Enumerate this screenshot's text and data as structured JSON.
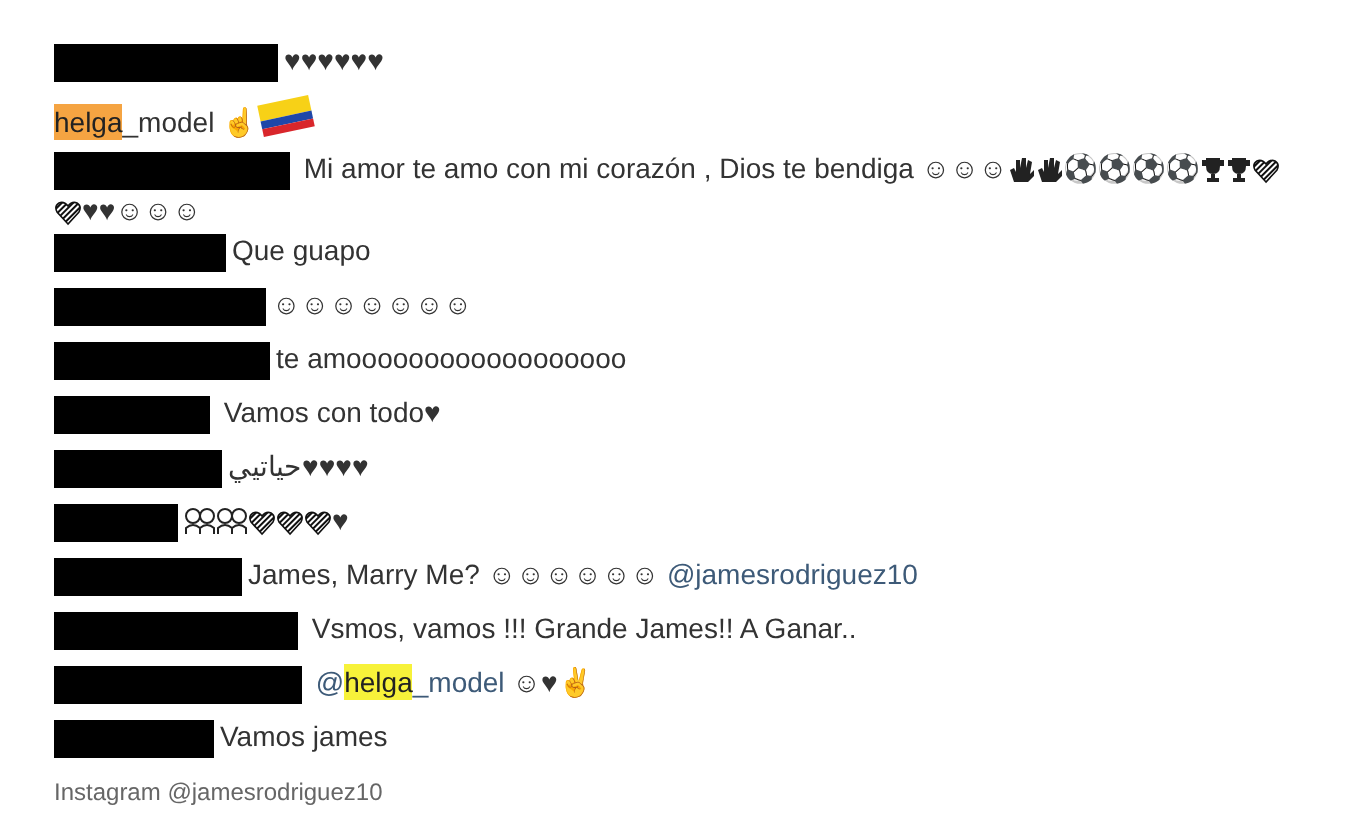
{
  "comments": [
    {
      "redacted": true,
      "segments": [
        {
          "kind": "text",
          "text": "♥♥♥♥♥♥"
        }
      ]
    },
    {
      "redacted": false,
      "segments": [
        {
          "kind": "highlight",
          "text": "helga",
          "color": "#f5a442"
        },
        {
          "kind": "text",
          "text": "_model "
        },
        {
          "kind": "text",
          "text": "☝"
        },
        {
          "kind": "flag"
        }
      ]
    },
    {
      "redacted": true,
      "segments": [
        {
          "kind": "text",
          "text": " Mi amor te amo con mi corazón , Dios te bendiga ☺☺☺"
        },
        {
          "kind": "hand"
        },
        {
          "kind": "hand"
        },
        {
          "kind": "text",
          "text": "⚽⚽⚽⚽"
        },
        {
          "kind": "trophy"
        },
        {
          "kind": "trophy"
        },
        {
          "kind": "stripe-heart"
        },
        {
          "kind": "stripe-heart"
        },
        {
          "kind": "text",
          "text": "♥♥☺☺☺"
        }
      ]
    },
    {
      "redacted": true,
      "segments": [
        {
          "kind": "text",
          "text": "Que guapo"
        }
      ]
    },
    {
      "redacted": true,
      "segments": [
        {
          "kind": "text",
          "text": "☺☺☺☺☺☺☺"
        }
      ]
    },
    {
      "redacted": true,
      "segments": [
        {
          "kind": "text",
          "text": "te amoooooooooooooooooo"
        }
      ]
    },
    {
      "redacted": true,
      "segments": [
        {
          "kind": "text",
          "text": " Vamos con todo♥"
        }
      ]
    },
    {
      "redacted": true,
      "segments": [
        {
          "kind": "text",
          "text": "حياتيي♥♥♥♥"
        }
      ]
    },
    {
      "redacted": true,
      "segments": [
        {
          "kind": "figures"
        },
        {
          "kind": "figures"
        },
        {
          "kind": "stripe-heart"
        },
        {
          "kind": "stripe-heart"
        },
        {
          "kind": "stripe-heart"
        },
        {
          "kind": "text",
          "text": "♥"
        }
      ]
    },
    {
      "redacted": true,
      "segments": [
        {
          "kind": "text",
          "text": "James, Marry Me? ☺☺☺☺☺☺ "
        },
        {
          "kind": "mention",
          "text": "@jamesrodriguez10"
        }
      ]
    },
    {
      "redacted": true,
      "segments": [
        {
          "kind": "text",
          "text": " Vsmos, vamos !!! Grande James!! A Ganar.."
        }
      ]
    },
    {
      "redacted": true,
      "segments": [
        {
          "kind": "mention",
          "text": " @"
        },
        {
          "kind": "highlight",
          "text": "helga",
          "color": "#f7f23a"
        },
        {
          "kind": "mention",
          "text": "_model"
        },
        {
          "kind": "text",
          "text": " ☺♥✌"
        }
      ]
    },
    {
      "redacted": true,
      "segments": [
        {
          "kind": "text",
          "text": "Vamos james"
        }
      ]
    }
  ],
  "credit": "Instagram @jamesrodriguez10"
}
